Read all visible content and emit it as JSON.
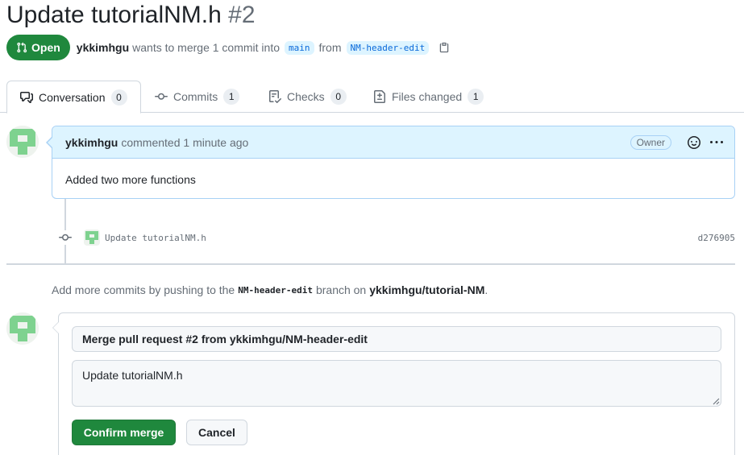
{
  "pr": {
    "title": "Update tutorialNM.h",
    "number": "#2",
    "state": "Open",
    "author": "ykkimhgu",
    "wants_text": "wants to merge 1 commit into",
    "base_branch": "main",
    "from_text": "from",
    "head_branch": "NM-header-edit"
  },
  "tabs": [
    {
      "label": "Conversation",
      "count": "0"
    },
    {
      "label": "Commits",
      "count": "1"
    },
    {
      "label": "Checks",
      "count": "0"
    },
    {
      "label": "Files changed",
      "count": "1"
    }
  ],
  "comment": {
    "author": "ykkimhgu",
    "action": "commented 1 minute ago",
    "badge": "Owner",
    "body": "Added two more functions"
  },
  "commit": {
    "message": "Update tutorialNM.h",
    "sha": "d276905"
  },
  "info": {
    "prefix": "Add more commits by pushing to the",
    "branch": "NM-header-edit",
    "middle": "branch on",
    "repo": "ykkimhgu/tutorial-NM",
    "suffix": "."
  },
  "merge": {
    "title_value": "Merge pull request #2 from ykkimhgu/NM-header-edit",
    "body_value": "Update tutorialNM.h",
    "confirm_label": "Confirm merge",
    "cancel_label": "Cancel"
  },
  "colors": {
    "accent_green": "#1f883d",
    "link_blue": "#0969da",
    "comment_header_bg": "#ddf4ff",
    "avatar_green": "#7ed28f"
  },
  "icons": {
    "state": "git-pull-request-icon",
    "copy": "copy-icon",
    "conversation": "comment-discussion-icon",
    "commits": "git-commit-icon",
    "checks": "checklist-icon",
    "files": "file-diff-icon",
    "emoji": "smiley-icon",
    "more": "kebab-horizontal-icon"
  }
}
